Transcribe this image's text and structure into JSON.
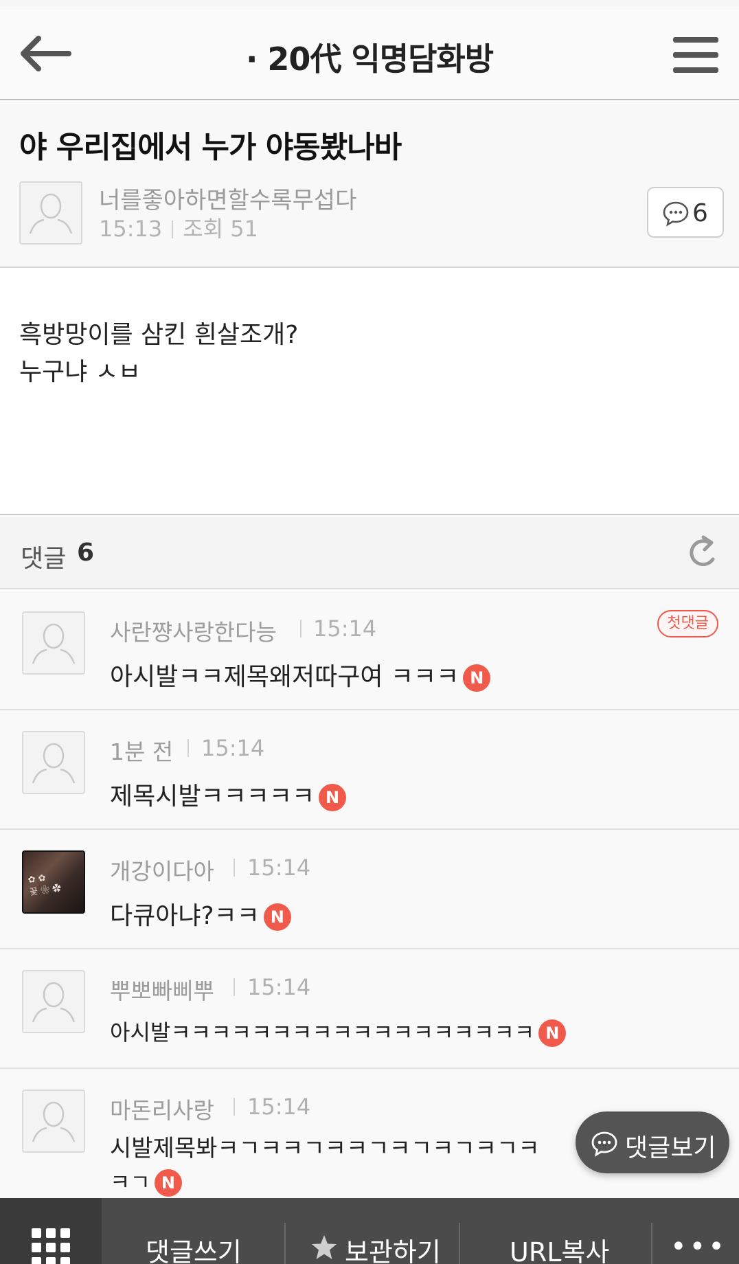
{
  "header": {
    "title": "· 20代 익명담화방"
  },
  "post": {
    "title": "야 우리집에서 누가 야동봤나바",
    "author": "너를좋아하면할수록무섭다",
    "time": "15:13",
    "views": "조회 51",
    "comment_count": "6",
    "body_lines": [
      "흑방망이를 삼킨 흰살조개?",
      "누구냐 ㅅㅂ"
    ]
  },
  "comments_header": {
    "label": "댓글",
    "count": "6"
  },
  "comments": [
    {
      "author": "사란쨩사랑한다능",
      "time": "15:14",
      "text": "아시발ㅋㅋ제목왜저따구여 ㅋㅋㅋ",
      "badge": "N",
      "first_label": "첫댓글",
      "avatar": "default"
    },
    {
      "author": "1분 전",
      "time": "15:14",
      "text": "제목시발ㅋㅋㅋㅋㅋ",
      "badge": "N",
      "avatar": "default"
    },
    {
      "author": "개강이다아",
      "time": "15:14",
      "text": "다큐아냐?ㅋㅋ",
      "badge": "N",
      "avatar": "photo"
    },
    {
      "author": "뿌뽀빠삐뿌",
      "time": "15:14",
      "text": "아시발ㅋㅋㅋㅋㅋㅋㅋㅋㅋㅋㅋㅋㅋㅋㅋㅋㅋㅋ",
      "badge": "N",
      "avatar": "default"
    },
    {
      "author": "마돈리사랑",
      "time": "15:14",
      "text_line1": "시발제목봐ㅋㄱㅋㅋㄱㅋㅋㄱㅋㄱㅋㄱㅋㄱㅋ",
      "text_line2": "ㅋㄱ",
      "badge": "N",
      "avatar": "default"
    }
  ],
  "floating_button": {
    "label": "댓글보기"
  },
  "toolbar": {
    "write_comment": "댓글쓰기",
    "bookmark": "보관하기",
    "copy_url": "URL복사",
    "more": "•••"
  },
  "colors": {
    "badge": "#ef5a4b",
    "toolbar": "#4b4b4b",
    "header_bg": "#fbfbfb"
  },
  "icons": [
    "back-arrow-icon",
    "hamburger-menu-icon",
    "speech-bubble-icon",
    "refresh-icon",
    "default-avatar-icon",
    "grid-icon",
    "star-icon",
    "more-dots-icon"
  ]
}
